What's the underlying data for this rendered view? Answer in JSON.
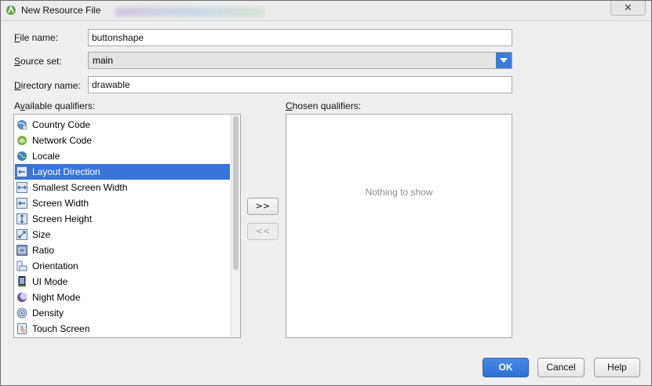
{
  "window": {
    "title": "New Resource File",
    "close_glyph": "✕"
  },
  "form": {
    "file_name_label_first": "F",
    "file_name_label_rest": "ile name:",
    "file_name_value": "buttonshape",
    "source_set_label_first": "S",
    "source_set_label_rest": "ource set:",
    "source_set_value": "main",
    "directory_label_first": "D",
    "directory_label_rest": "irectory name:",
    "directory_value": "drawable"
  },
  "qualifiers": {
    "available_label_pre": "A",
    "available_label_u": "v",
    "available_label_rest": "ailable qualifiers:",
    "chosen_label_pre": "",
    "chosen_label_u": "C",
    "chosen_label_rest": "hosen qualifiers:",
    "available_items": [
      {
        "label": "Country Code",
        "icon": "country-code-icon"
      },
      {
        "label": "Network Code",
        "icon": "network-code-icon"
      },
      {
        "label": "Locale",
        "icon": "locale-icon"
      },
      {
        "label": "Layout Direction",
        "icon": "layout-direction-icon",
        "selected": true
      },
      {
        "label": "Smallest Screen Width",
        "icon": "smallest-screen-width-icon"
      },
      {
        "label": "Screen Width",
        "icon": "screen-width-icon"
      },
      {
        "label": "Screen Height",
        "icon": "screen-height-icon"
      },
      {
        "label": "Size",
        "icon": "size-icon"
      },
      {
        "label": "Ratio",
        "icon": "ratio-icon"
      },
      {
        "label": "Orientation",
        "icon": "orientation-icon"
      },
      {
        "label": "UI Mode",
        "icon": "ui-mode-icon"
      },
      {
        "label": "Night Mode",
        "icon": "night-mode-icon"
      },
      {
        "label": "Density",
        "icon": "density-icon"
      },
      {
        "label": "Touch Screen",
        "icon": "touch-screen-icon"
      }
    ],
    "chosen_empty_text": "Nothing to show",
    "add_button": ">>",
    "remove_button": "<<"
  },
  "buttons": {
    "ok": "OK",
    "cancel": "Cancel",
    "help": "Help"
  },
  "colors": {
    "selection": "#3875d7",
    "ok_button": "#2f6fd1"
  }
}
